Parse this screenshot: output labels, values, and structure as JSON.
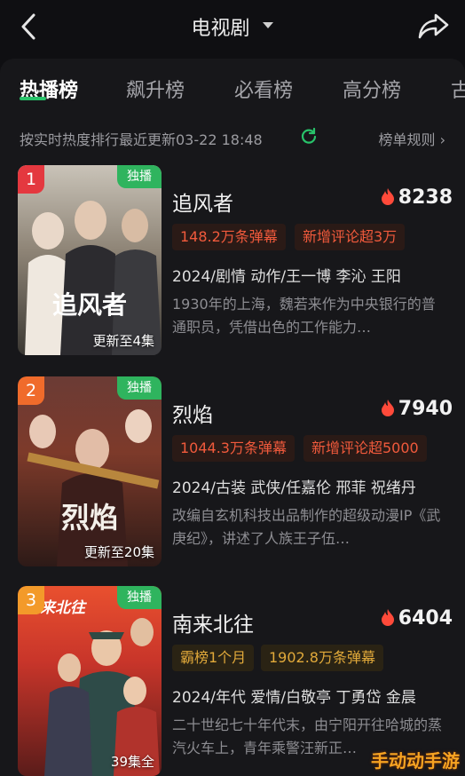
{
  "header": {
    "title": "电视剧",
    "back_icon": "back-chevron-icon",
    "share_icon": "share-icon"
  },
  "tabs": [
    {
      "label": "热播榜",
      "active": true
    },
    {
      "label": "飙升榜",
      "active": false
    },
    {
      "label": "必看榜",
      "active": false
    },
    {
      "label": "高分榜",
      "active": false
    },
    {
      "label": "古",
      "active": false
    }
  ],
  "subhead": {
    "update_text": "按实时热度排行最近更新03-22 18:48",
    "rules_label": "榜单规则 ›"
  },
  "colors": {
    "accent_green": "#28c36a",
    "rank_1": "#e4383f",
    "rank_2": "#f06b2b",
    "rank_3": "#f39a2a",
    "flame": "#ff4a3a"
  },
  "list": [
    {
      "rank": "1",
      "badge": "独播",
      "poster_title": "追风者",
      "update": "更新至4集",
      "name": "追风者",
      "heat": "8238",
      "tags": [
        {
          "text": "148.2万条弹幕",
          "style": "red"
        },
        {
          "text": "新增评论超3万",
          "style": "red"
        }
      ],
      "meta": "2024/剧情 动作/王一博 李沁 王阳",
      "desc": "1930年的上海，魏若来作为中央银行的普通职员，凭借出色的工作能力…"
    },
    {
      "rank": "2",
      "badge": "独播",
      "poster_title": "烈焰",
      "update": "更新至20集",
      "name": "烈焰",
      "heat": "7940",
      "tags": [
        {
          "text": "1044.3万条弹幕",
          "style": "red"
        },
        {
          "text": "新增评论超5000",
          "style": "red"
        }
      ],
      "meta": "2024/古装 武侠/任嘉伦 邢菲 祝绪丹",
      "desc": "改编自玄机科技出品制作的超级动漫IP《武庚纪》，讲述了人族王子伍…"
    },
    {
      "rank": "3",
      "badge": "独播",
      "poster_title": "南来北往",
      "update": "39集全",
      "name": "南来北往",
      "heat": "6404",
      "tags": [
        {
          "text": "霸榜1个月",
          "style": "gold"
        },
        {
          "text": "1902.8万条弹幕",
          "style": "gold"
        }
      ],
      "meta": "2024/年代 爱情/白敬亭 丁勇岱 金晨",
      "desc": "二十世纪七十年代末，由宁阳开往哈城的蒸汽火车上，青年乘警汪新正…"
    }
  ],
  "watermark": "手动动手游"
}
